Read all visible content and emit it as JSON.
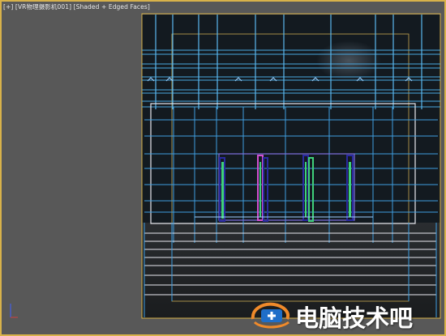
{
  "viewport": {
    "label_plus": "[+]",
    "label_camera": "[VR物理摄影机001]",
    "label_shading": "[Shaded + Edged Faces]",
    "axis_x": "x",
    "axis_z": "z"
  },
  "watermark": {
    "text": "电脑技术吧"
  },
  "colors": {
    "viewport_bg": "#585858",
    "camera_frame": "#d8b24a",
    "wire_cyan": "#4aa8e0",
    "wire_light": "#9fd0ff",
    "glass_green": "#3fd07a",
    "glass_magenta": "#d050d0",
    "room_dark": "#101820"
  }
}
